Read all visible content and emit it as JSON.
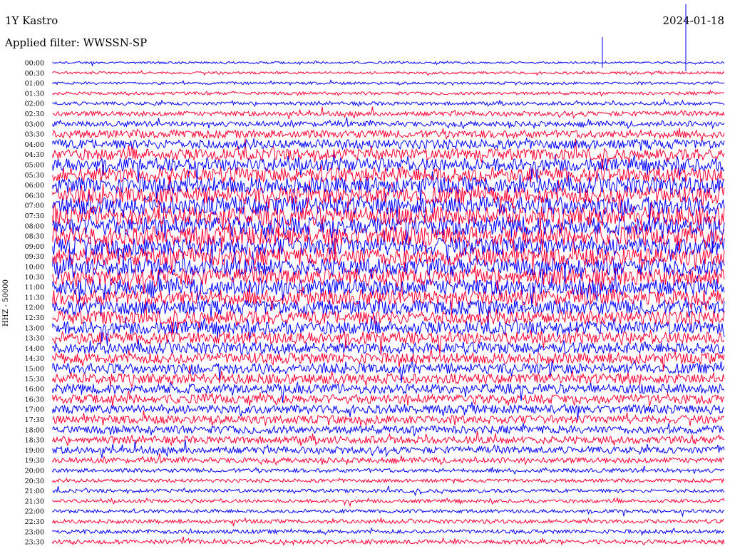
{
  "header": {
    "station": "1Y Kastro",
    "date": "2024-01-18",
    "filter": "Applied filter: WWSSN-SP"
  },
  "colors": {
    "trace_a": "#0000ff",
    "trace_b": "#ff0033",
    "background": "#ffffff"
  },
  "chart_data": {
    "type": "line",
    "title": "1Y Kastro",
    "ylabel": "HHZ - 50000",
    "ytick_labels": [
      "00:00",
      "00:30",
      "01:00",
      "01:30",
      "02:00",
      "02:30",
      "03:00",
      "03:30",
      "04:00",
      "04:30",
      "05:00",
      "05:30",
      "06:00",
      "06:30",
      "07:00",
      "07:30",
      "08:00",
      "08:30",
      "09:00",
      "09:30",
      "10:00",
      "10:30",
      "11:00",
      "11:30",
      "12:00",
      "12:30",
      "13:00",
      "13:30",
      "14:00",
      "14:30",
      "15:00",
      "15:30",
      "16:00",
      "16:30",
      "17:00",
      "17:30",
      "18:00",
      "18:30",
      "19:00",
      "19:30",
      "20:00",
      "20:30",
      "21:00",
      "21:30",
      "22:00",
      "22:30",
      "23:00",
      "23:30"
    ],
    "series_colors": [
      "#0000ff",
      "#ff0033"
    ],
    "relative_amplitude": [
      0.25,
      0.3,
      0.3,
      0.35,
      0.4,
      0.55,
      0.6,
      0.9,
      1.1,
      1.3,
      1.5,
      1.7,
      1.9,
      2.0,
      2.1,
      2.2,
      2.2,
      2.2,
      2.1,
      2.1,
      2.0,
      2.0,
      1.9,
      1.8,
      1.7,
      1.6,
      1.5,
      1.4,
      1.3,
      1.25,
      1.2,
      1.15,
      1.1,
      1.05,
      1.0,
      0.95,
      0.9,
      0.85,
      0.8,
      0.6,
      0.45,
      0.4,
      0.4,
      0.4,
      0.4,
      0.45,
      0.45,
      0.5
    ],
    "grid": false,
    "legend": "none"
  }
}
